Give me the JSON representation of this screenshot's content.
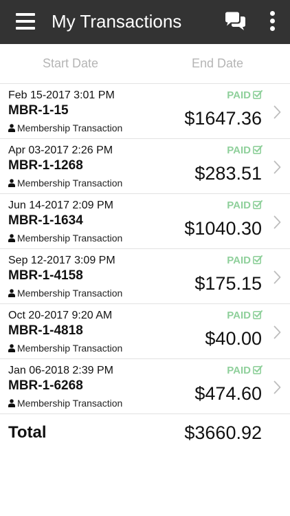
{
  "header": {
    "title": "My Transactions",
    "menu_icon": "hamburger-menu-icon",
    "chat_icon": "chat-bubbles-icon",
    "more_icon": "vertical-ellipsis-icon",
    "background_color": "#333333"
  },
  "filters": {
    "start_date_placeholder": "Start Date",
    "end_date_placeholder": "End Date"
  },
  "transactions": [
    {
      "date": "Feb 15-2017 3:01 PM",
      "id": "MBR-1-15",
      "type": "Membership Transaction",
      "status": "PAID",
      "amount": "$1647.36"
    },
    {
      "date": "Apr 03-2017 2:26 PM",
      "id": "MBR-1-1268",
      "type": "Membership Transaction",
      "status": "PAID",
      "amount": "$283.51"
    },
    {
      "date": "Jun 14-2017 2:09 PM",
      "id": "MBR-1-1634",
      "type": "Membership Transaction",
      "status": "PAID",
      "amount": "$1040.30"
    },
    {
      "date": "Sep 12-2017 3:09 PM",
      "id": "MBR-1-4158",
      "type": "Membership Transaction",
      "status": "PAID",
      "amount": "$175.15"
    },
    {
      "date": "Oct 20-2017 9:20 AM",
      "id": "MBR-1-4818",
      "type": "Membership Transaction",
      "status": "PAID",
      "amount": "$40.00"
    },
    {
      "date": "Jan 06-2018 2:39 PM",
      "id": "MBR-1-6268",
      "type": "Membership Transaction",
      "status": "PAID",
      "amount": "$474.60"
    }
  ],
  "total": {
    "label": "Total",
    "amount": "$3660.92"
  },
  "colors": {
    "paid_status": "#8fd09b",
    "placeholder_text": "#b5b5b5",
    "divider": "#e2e2e2"
  }
}
